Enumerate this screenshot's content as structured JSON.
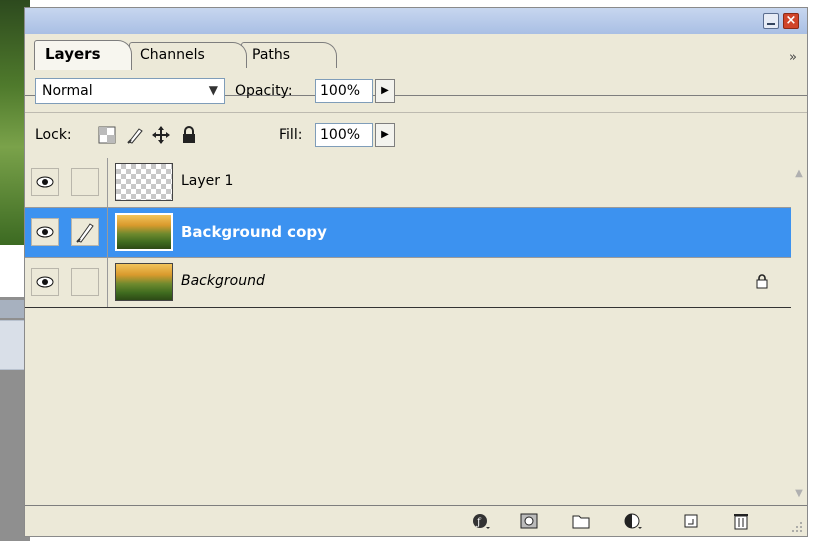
{
  "panel": {
    "title_buttons": {
      "minimize_icon": "minimize-icon",
      "close_label": "×"
    },
    "tabs": [
      {
        "label": "Layers",
        "active": true
      },
      {
        "label": "Channels",
        "active": false
      },
      {
        "label": "Paths",
        "active": false
      }
    ],
    "tabs_more": "»",
    "blend_mode": "Normal",
    "opacity_label": "Opacity:",
    "opacity_value": "100%",
    "lock_label": "Lock:",
    "fill_label": "Fill:",
    "fill_value": "100%",
    "layers": [
      {
        "name": "Layer 1",
        "visible": true,
        "selected": false,
        "thumb": "transparent",
        "locked": false
      },
      {
        "name": "Background copy",
        "visible": true,
        "selected": true,
        "thumb": "photo",
        "locked": false
      },
      {
        "name": "Background",
        "visible": true,
        "selected": false,
        "thumb": "photo",
        "locked": true
      }
    ],
    "bottom_icons": [
      "layer-style-icon",
      "layer-mask-icon",
      "new-group-icon",
      "adjustment-layer-icon",
      "new-layer-icon",
      "trash-icon"
    ],
    "colors": {
      "selection": "#3c92f0",
      "panel_bg": "#ece9d8",
      "titlebar": "#a9bfe4"
    }
  }
}
